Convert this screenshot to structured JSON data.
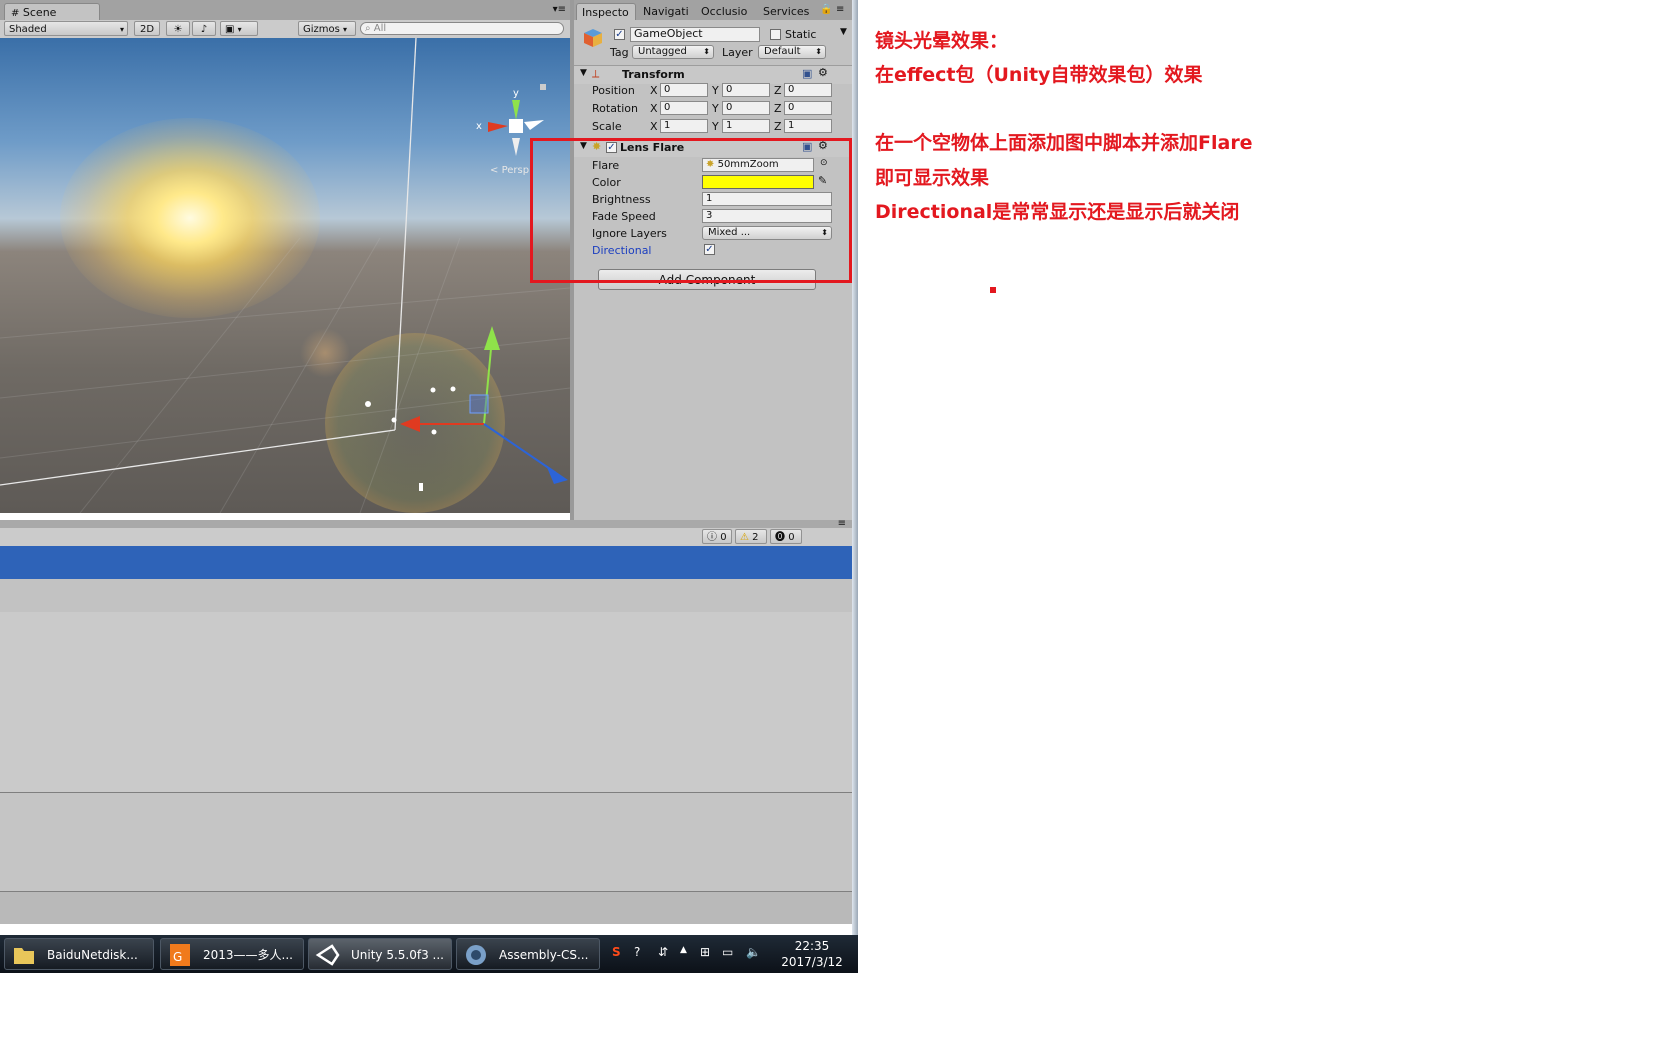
{
  "scene": {
    "tab_label": "Scene",
    "shading": "Shaded",
    "mode_2d": "2D",
    "gizmos": "Gizmos",
    "search_placeholder": "All",
    "axis_x": "x",
    "axis_y": "y",
    "persp": "Persp"
  },
  "inspector": {
    "tabs": [
      "Inspecto",
      "Navigati",
      "Occlusio",
      "Services"
    ],
    "object_name": "GameObject",
    "static_label": "Static",
    "tag_label": "Tag",
    "tag_value": "Untagged",
    "layer_label": "Layer",
    "layer_value": "Default",
    "transform": {
      "title": "Transform",
      "rows": [
        {
          "label": "Position",
          "x": "0",
          "y": "0",
          "z": "0"
        },
        {
          "label": "Rotation",
          "x": "0",
          "y": "0",
          "z": "0"
        },
        {
          "label": "Scale",
          "x": "1",
          "y": "1",
          "z": "1"
        }
      ],
      "axis_labels": [
        "X",
        "Y",
        "Z"
      ]
    },
    "lens_flare": {
      "title": "Lens Flare",
      "flare_label": "Flare",
      "flare_value": "50mmZoom",
      "color_label": "Color",
      "color_value": "#ffff00",
      "brightness_label": "Brightness",
      "brightness_value": "1",
      "fade_speed_label": "Fade Speed",
      "fade_speed_value": "3",
      "ignore_layers_label": "Ignore Layers",
      "ignore_layers_value": "Mixed ...",
      "directional_label": "Directional",
      "directional_checked": true
    },
    "add_component": "Add Component"
  },
  "console": {
    "info_count": "0",
    "warning_count": "2",
    "error_count": "0"
  },
  "taskbar": {
    "items": [
      {
        "label": "BaiduNetdisk..."
      },
      {
        "label": "2013——多人..."
      },
      {
        "label": "Unity 5.5.0f3 ..."
      },
      {
        "label": "Assembly-CS..."
      }
    ],
    "time": "22:35",
    "date": "2017/3/12"
  },
  "annotations": [
    "镜头光晕效果：",
    "在effect包（Unity自带效果包）效果",
    "在一个空物体上面添加图中脚本并添加Flare",
    "即可显示效果",
    "Directional是常常显示还是显示后就关闭"
  ],
  "colors": {
    "accent_red": "#e3181f",
    "selection_blue": "#2e63b8",
    "flare_color": "#ffff00"
  }
}
